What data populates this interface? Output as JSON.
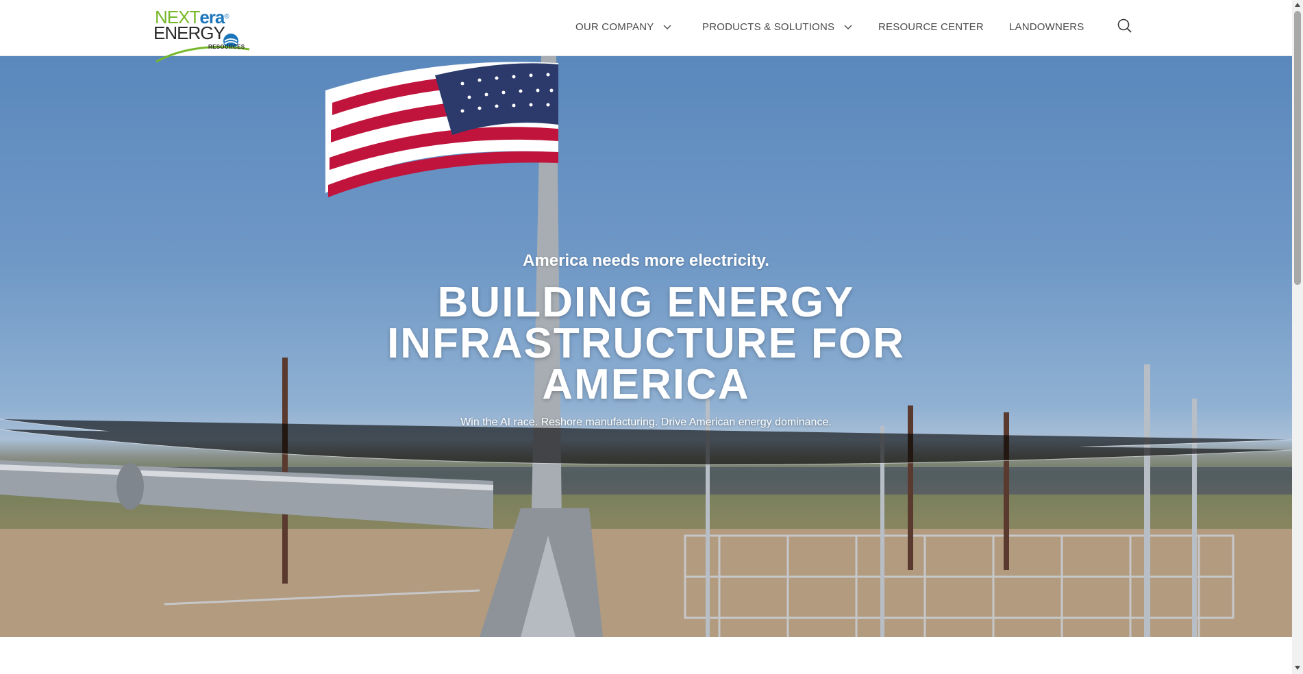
{
  "header": {
    "logo": {
      "line1_a": "NEXT",
      "line1_b": "era",
      "line2": "ENERGY",
      "line3": "RESOURCES"
    },
    "nav": [
      {
        "label": "OUR COMPANY",
        "has_dropdown": true
      },
      {
        "label": "PRODUCTS & SOLUTIONS",
        "has_dropdown": true
      },
      {
        "label": "RESOURCE CENTER",
        "has_dropdown": false
      },
      {
        "label": "LANDOWNERS",
        "has_dropdown": false
      }
    ],
    "search_icon": "search-icon"
  },
  "hero": {
    "eyebrow": "America needs more electricity.",
    "headline_line1": "BUILDING ENERGY",
    "headline_line2": "INFRASTRUCTURE FOR",
    "headline_line3": "AMERICA",
    "subline": "Win the AI race. Reshore manufacturing. Drive American energy dominance."
  },
  "colors": {
    "brand_green": "#76b82a",
    "brand_blue": "#1b75bb",
    "nav_text": "#4a4a4a",
    "flag_red": "#c0143c",
    "flag_blue": "#2b3a6b"
  }
}
